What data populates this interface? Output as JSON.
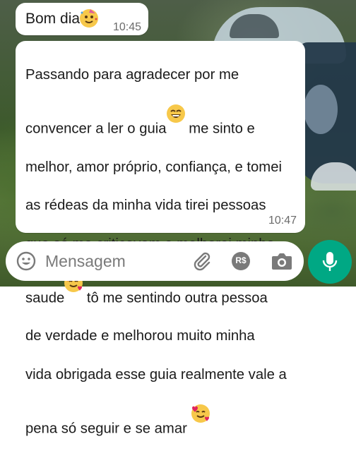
{
  "messages": [
    {
      "text": "Bom dia",
      "time": "10:45",
      "emoji": "party-face"
    },
    {
      "line1": "Passando para agradecer por me",
      "line2a": "convencer a ler o guia",
      "line2b": " me sinto e",
      "line3": "melhor, amor próprio, confiança, e tomei",
      "line4": "as rédeas da minha vida tirei pessoas",
      "line5": "que só me criticavam e melhorei minha",
      "line6a": "saude",
      "line6b": " tô me sentindo outra pessoa",
      "line7": "de verdade e melhorou muito minha",
      "line8": "vida obrigada esse guia realmente vale a",
      "line9": "pena só seguir e se amar ",
      "time": "10:47"
    }
  ],
  "composer": {
    "placeholder": "Mensagem",
    "icons": [
      "emoji-icon",
      "attach-icon",
      "payment-icon",
      "camera-icon",
      "mic-icon"
    ],
    "payment_label": "R$"
  },
  "colors": {
    "accent": "#00a884",
    "bubble": "#ffffff"
  }
}
